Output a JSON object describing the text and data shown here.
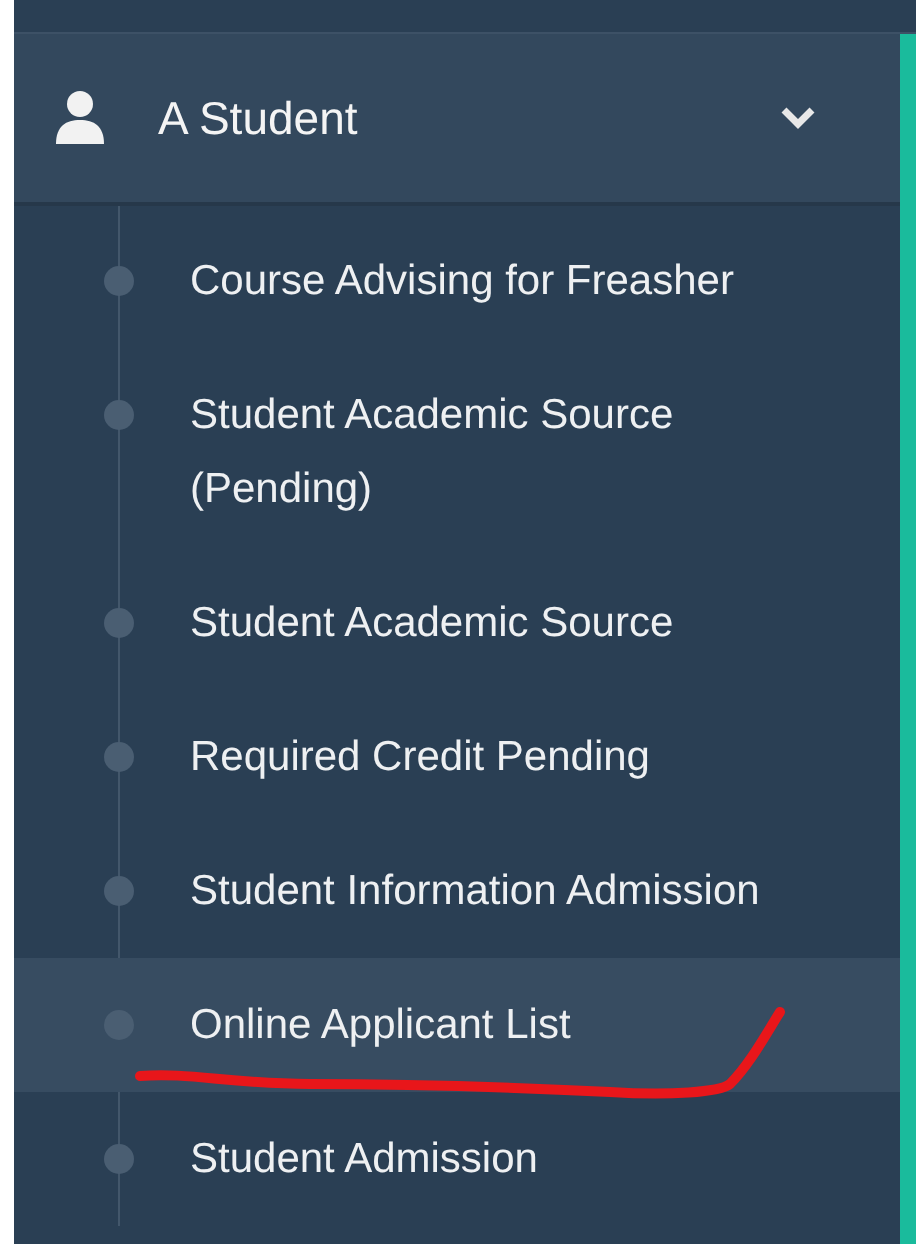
{
  "sidebar": {
    "section": {
      "title": "A Student",
      "expanded": true
    },
    "items": [
      {
        "label": "Course Advising for Freasher",
        "selected": false
      },
      {
        "label": "Student Academic Source (Pending)",
        "selected": false
      },
      {
        "label": "Student Academic Source",
        "selected": false
      },
      {
        "label": "Required Credit Pending",
        "selected": false
      },
      {
        "label": "Student Information Admission",
        "selected": false
      },
      {
        "label": "Online Applicant List",
        "selected": true
      },
      {
        "label": "Student Admission",
        "selected": false
      }
    ]
  }
}
